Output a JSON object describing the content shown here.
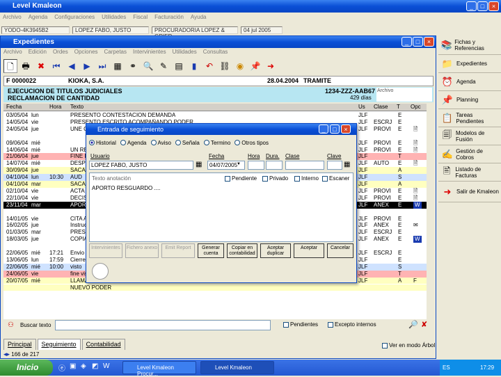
{
  "outer_window": {
    "title": "Level Kmaleon",
    "menu": [
      "Archivo",
      "Agenda",
      "Configuraciones",
      "Utilidades",
      "Fiscal",
      "Facturación",
      "Ayuda"
    ],
    "status": [
      "YODO-4K3945B2",
      "LOPEZ FABO, JUSTO",
      "PROCURADORIA LOPEZ & GRIER",
      "04 jul 2005"
    ]
  },
  "inner_window": {
    "title": "Expedientes",
    "menu": [
      "Archivo",
      "Edición",
      "Ordes",
      "Opciones",
      "Carpetas",
      "Intervinientes",
      "Utilidades",
      "Consultas"
    ],
    "toolbar_icons": [
      "new-doc-icon",
      "print-icon",
      "delete-icon",
      "first-record-icon",
      "prev-record-icon",
      "next-record-icon",
      "last-record-icon",
      "table-view-icon",
      "binoculars-icon",
      "search-icon",
      "edit-icon",
      "grid-icon",
      "chart-icon",
      "undo-icon",
      "link-icon",
      "globe-icon",
      "pin-icon",
      "arrow-right-icon"
    ],
    "record": {
      "code": "F 0000022",
      "client": "KIOKA, S.A.",
      "date": "28.04.2004",
      "state": "TRAMITE"
    },
    "case": {
      "line1": "EJECUCION DE TITULOS JUDICIALES",
      "line2": "RECLAMACION DE CANTIDAD",
      "ref": "1234-ZZZ-AAB67",
      "days": "429 días",
      "archive_label": "Archivo"
    },
    "table": {
      "headers": [
        "Fecha",
        "Hora",
        "Texto",
        "Us",
        "Clase",
        "T",
        "Opc"
      ],
      "rows": [
        {
          "date": "03/05/04",
          "day": "lun",
          "time": "",
          "text": "PRESENTO CONTESTACION DEMANDA",
          "us": "JLF",
          "clase": "",
          "t": "E",
          "opc": "",
          "color": "white"
        },
        {
          "date": "14/05/04",
          "day": "vie",
          "time": "",
          "text": "PRESENTO ESCRITO ACOMPAÑANDO PODER",
          "us": "JLF",
          "clase": "ESCRJ",
          "t": "E",
          "opc": "",
          "color": "white"
        },
        {
          "date": "24/05/04",
          "day": "jue",
          "time": "",
          "text": "UNE C",
          "us": "JLF",
          "clase": "PROVI",
          "t": "E",
          "opc": "doc",
          "color": "white"
        },
        {
          "date": "",
          "day": "",
          "time": "",
          "text": "",
          "us": "",
          "clase": "",
          "t": "",
          "opc": "",
          "color": "white"
        },
        {
          "date": "09/06/04",
          "day": "mié",
          "time": "",
          "text": "",
          "us": "JLF",
          "clase": "PROVI",
          "t": "E",
          "opc": "doc",
          "color": "white"
        },
        {
          "date": "14/06/04",
          "day": "mié",
          "time": "",
          "text": "UN RE",
          "us": "JLF",
          "clase": "PROVI",
          "t": "E",
          "opc": "doc",
          "color": "white"
        },
        {
          "date": "21/06/04",
          "day": "jue",
          "time": "",
          "text": "FINE P",
          "us": "JLF",
          "clase": "",
          "t": "T",
          "opc": "",
          "color": "red"
        },
        {
          "date": "14/07/04",
          "day": "mié",
          "time": "",
          "text": "DESPE",
          "us": "JLF",
          "clase": "AUTO",
          "t": "E",
          "opc": "doc",
          "color": "white"
        },
        {
          "date": "30/09/04",
          "day": "jue",
          "time": "",
          "text": "SACAR",
          "us": "JLF",
          "clase": "",
          "t": "A",
          "opc": "",
          "color": "yellow"
        },
        {
          "date": "04/10/04",
          "day": "lun",
          "time": "10:30",
          "text": "AUD",
          "us": "JLF",
          "clase": "",
          "t": "S",
          "opc": "",
          "color": "blue"
        },
        {
          "date": "04/10/04",
          "day": "mar",
          "time": "",
          "text": "SACAR",
          "us": "JLF",
          "clase": "",
          "t": "A",
          "opc": "",
          "color": "yellow"
        },
        {
          "date": "02/10/04",
          "day": "vie",
          "time": "",
          "text": "ACTA",
          "us": "JLF",
          "clase": "PROVI",
          "t": "E",
          "opc": "doc",
          "color": "white"
        },
        {
          "date": "22/10/04",
          "day": "vie",
          "time": "",
          "text": "DECIS",
          "us": "JLF",
          "clase": "PROVI",
          "t": "E",
          "opc": "doc",
          "color": "white"
        },
        {
          "date": "23/11/04",
          "day": "mar",
          "time": "",
          "text": "APORT",
          "us": "JLF",
          "clase": "ANEX",
          "t": "E",
          "opc": "W",
          "color": "black"
        },
        {
          "date": "",
          "day": "",
          "time": "",
          "text": "",
          "us": "",
          "clase": "",
          "t": "",
          "opc": "",
          "color": "white"
        },
        {
          "date": "14/01/05",
          "day": "vie",
          "time": "",
          "text": "CITA A",
          "us": "JLF",
          "clase": "PROVI",
          "t": "E",
          "opc": "",
          "color": "white"
        },
        {
          "date": "16/02/05",
          "day": "jue",
          "time": "",
          "text": "Instruc",
          "us": "JLF",
          "clase": "ANEX",
          "t": "E",
          "opc": "mail",
          "color": "white"
        },
        {
          "date": "01/03/05",
          "day": "mar",
          "time": "",
          "text": "PRESEN",
          "us": "JLF",
          "clase": "ESCRJ",
          "t": "E",
          "opc": "",
          "color": "white"
        },
        {
          "date": "18/03/05",
          "day": "jue",
          "time": "",
          "text": "COPIA",
          "us": "JLF",
          "clase": "ANEX",
          "t": "E",
          "opc": "W",
          "color": "white"
        },
        {
          "date": "",
          "day": "",
          "time": "",
          "text": "",
          "us": "",
          "clase": "",
          "t": "",
          "opc": "",
          "color": "white"
        },
        {
          "date": "22/06/05",
          "day": "mié",
          "time": "17:21",
          "text": "Envio",
          "us": "JLF",
          "clase": "ESCRJ",
          "t": "E",
          "opc": "",
          "color": "white"
        },
        {
          "date": "13/06/05",
          "day": "lun",
          "time": "17:59",
          "text": "Cierre",
          "us": "JLF",
          "clase": "",
          "t": "E",
          "opc": "",
          "color": "white"
        },
        {
          "date": "22/06/05",
          "day": "mié",
          "time": "10:00",
          "text": "visto",
          "us": "JLF",
          "clase": "",
          "t": "S",
          "opc": "",
          "color": "blue"
        },
        {
          "date": "24/06/05",
          "day": "vie",
          "time": "",
          "text": "fine vis",
          "us": "JLF",
          "clase": "",
          "t": "T",
          "opc": "",
          "color": "red"
        },
        {
          "date": "20/07/05",
          "day": "mié",
          "time": "",
          "text": "LLAMA",
          "us": "JLF",
          "clase": "",
          "t": "A",
          "opc": "F",
          "color": "yellow"
        },
        {
          "date": "",
          "day": "",
          "time": "",
          "text": "NUEVO PODER",
          "us": "",
          "clase": "",
          "t": "",
          "opc": "",
          "color": "yellow"
        }
      ]
    },
    "search": {
      "label": "Buscar texto",
      "pendientes": "Pendientes",
      "excepto": "Excepto internos"
    },
    "tabs": [
      "Principal",
      "Seguimiento",
      "Contabilidad"
    ],
    "ver_modo": "Ver en modo Árbol",
    "page_indicator": "166 de 217"
  },
  "right_panel": [
    {
      "icon": "books-icon",
      "label": "Fichas y Referencias"
    },
    {
      "icon": "folder-icon",
      "label": "Expedientes"
    },
    {
      "icon": "clock-icon",
      "label": "Agenda"
    },
    {
      "icon": "pushpin-icon",
      "label": "Planning"
    },
    {
      "icon": "tasks-icon",
      "label": "Tareas Pendientes"
    },
    {
      "icon": "forms-icon",
      "label": "Modelos de Fusión"
    },
    {
      "icon": "money-icon",
      "label": "Gestión de Cobros"
    },
    {
      "icon": "list-icon",
      "label": "Listado de Facturas"
    },
    {
      "icon": "exit-icon",
      "label": "Salir de Kmaleon"
    }
  ],
  "modal": {
    "title": "Entrada de seguimiento",
    "radios": [
      "Historial",
      "Agenda",
      "Aviso",
      "Señala",
      "Termino",
      "Otros tipos"
    ],
    "labels": {
      "usuario": "Usuario",
      "fecha": "Fecha",
      "hora": "Hora",
      "dura": "Dura.",
      "clase": "Clase",
      "clave": "Clave",
      "texto": "Texto anotación",
      "pendiente": "Pendiente",
      "privado": "Privado",
      "interno": "Interno",
      "escaner": "Escaner"
    },
    "usuario_value": "LOPEZ FABO, JUSTO",
    "fecha_value": "04/07/2005",
    "note_text": "APORTO RESGUARDO ....",
    "buttons": [
      "Intervinientes",
      "Fichero anexo",
      "Emit Report",
      "Generar cuenta",
      "Copiar en contabilidad",
      "Aceptar duplicar",
      "Aceptar",
      "Cancelar"
    ]
  },
  "taskbar": {
    "start": "Inicio",
    "tasks": [
      "Level Kmaleon Procur...",
      "Level Kmaleon"
    ],
    "lang": "ES",
    "time": "17:29"
  }
}
